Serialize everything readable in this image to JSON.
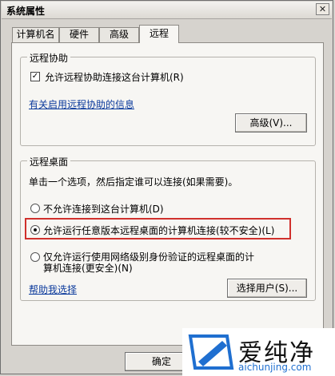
{
  "window": {
    "title": "系统属性",
    "close_glyph": "✕"
  },
  "tabs": [
    {
      "label": "计算机名"
    },
    {
      "label": "硬件"
    },
    {
      "label": "高级"
    },
    {
      "label": "远程"
    }
  ],
  "remote_assistance": {
    "group_label": "远程协助",
    "checkbox_label": "允许远程协助连接这台计算机(R)",
    "checked": true,
    "info_link": "有关启用远程协助的信息",
    "advanced_button": "高级(V)..."
  },
  "remote_desktop": {
    "group_label": "远程桌面",
    "instruction": "单击一个选项，然后指定谁可以连接(如果需要)。",
    "options": [
      {
        "label": "不允许连接到这台计算机(D)",
        "checked": false
      },
      {
        "label": "允许运行任意版本远程桌面的计算机连接(较不安全)(L)",
        "checked": true
      },
      {
        "label_line1": "仅允许运行使用网络级别身份验证的远程桌面的计",
        "label_line2": "算机连接(更安全)(N)",
        "checked": false
      }
    ],
    "help_link": "帮助我选择",
    "select_users_button": "选择用户(S)..."
  },
  "footer": {
    "ok_button": "确定"
  },
  "watermark": {
    "main": "爱纯净",
    "sub": "aichunjing.com"
  },
  "colors": {
    "highlight": "#d0302c",
    "link": "#0b3a9c",
    "watermark_sub": "#1f6fd0"
  }
}
